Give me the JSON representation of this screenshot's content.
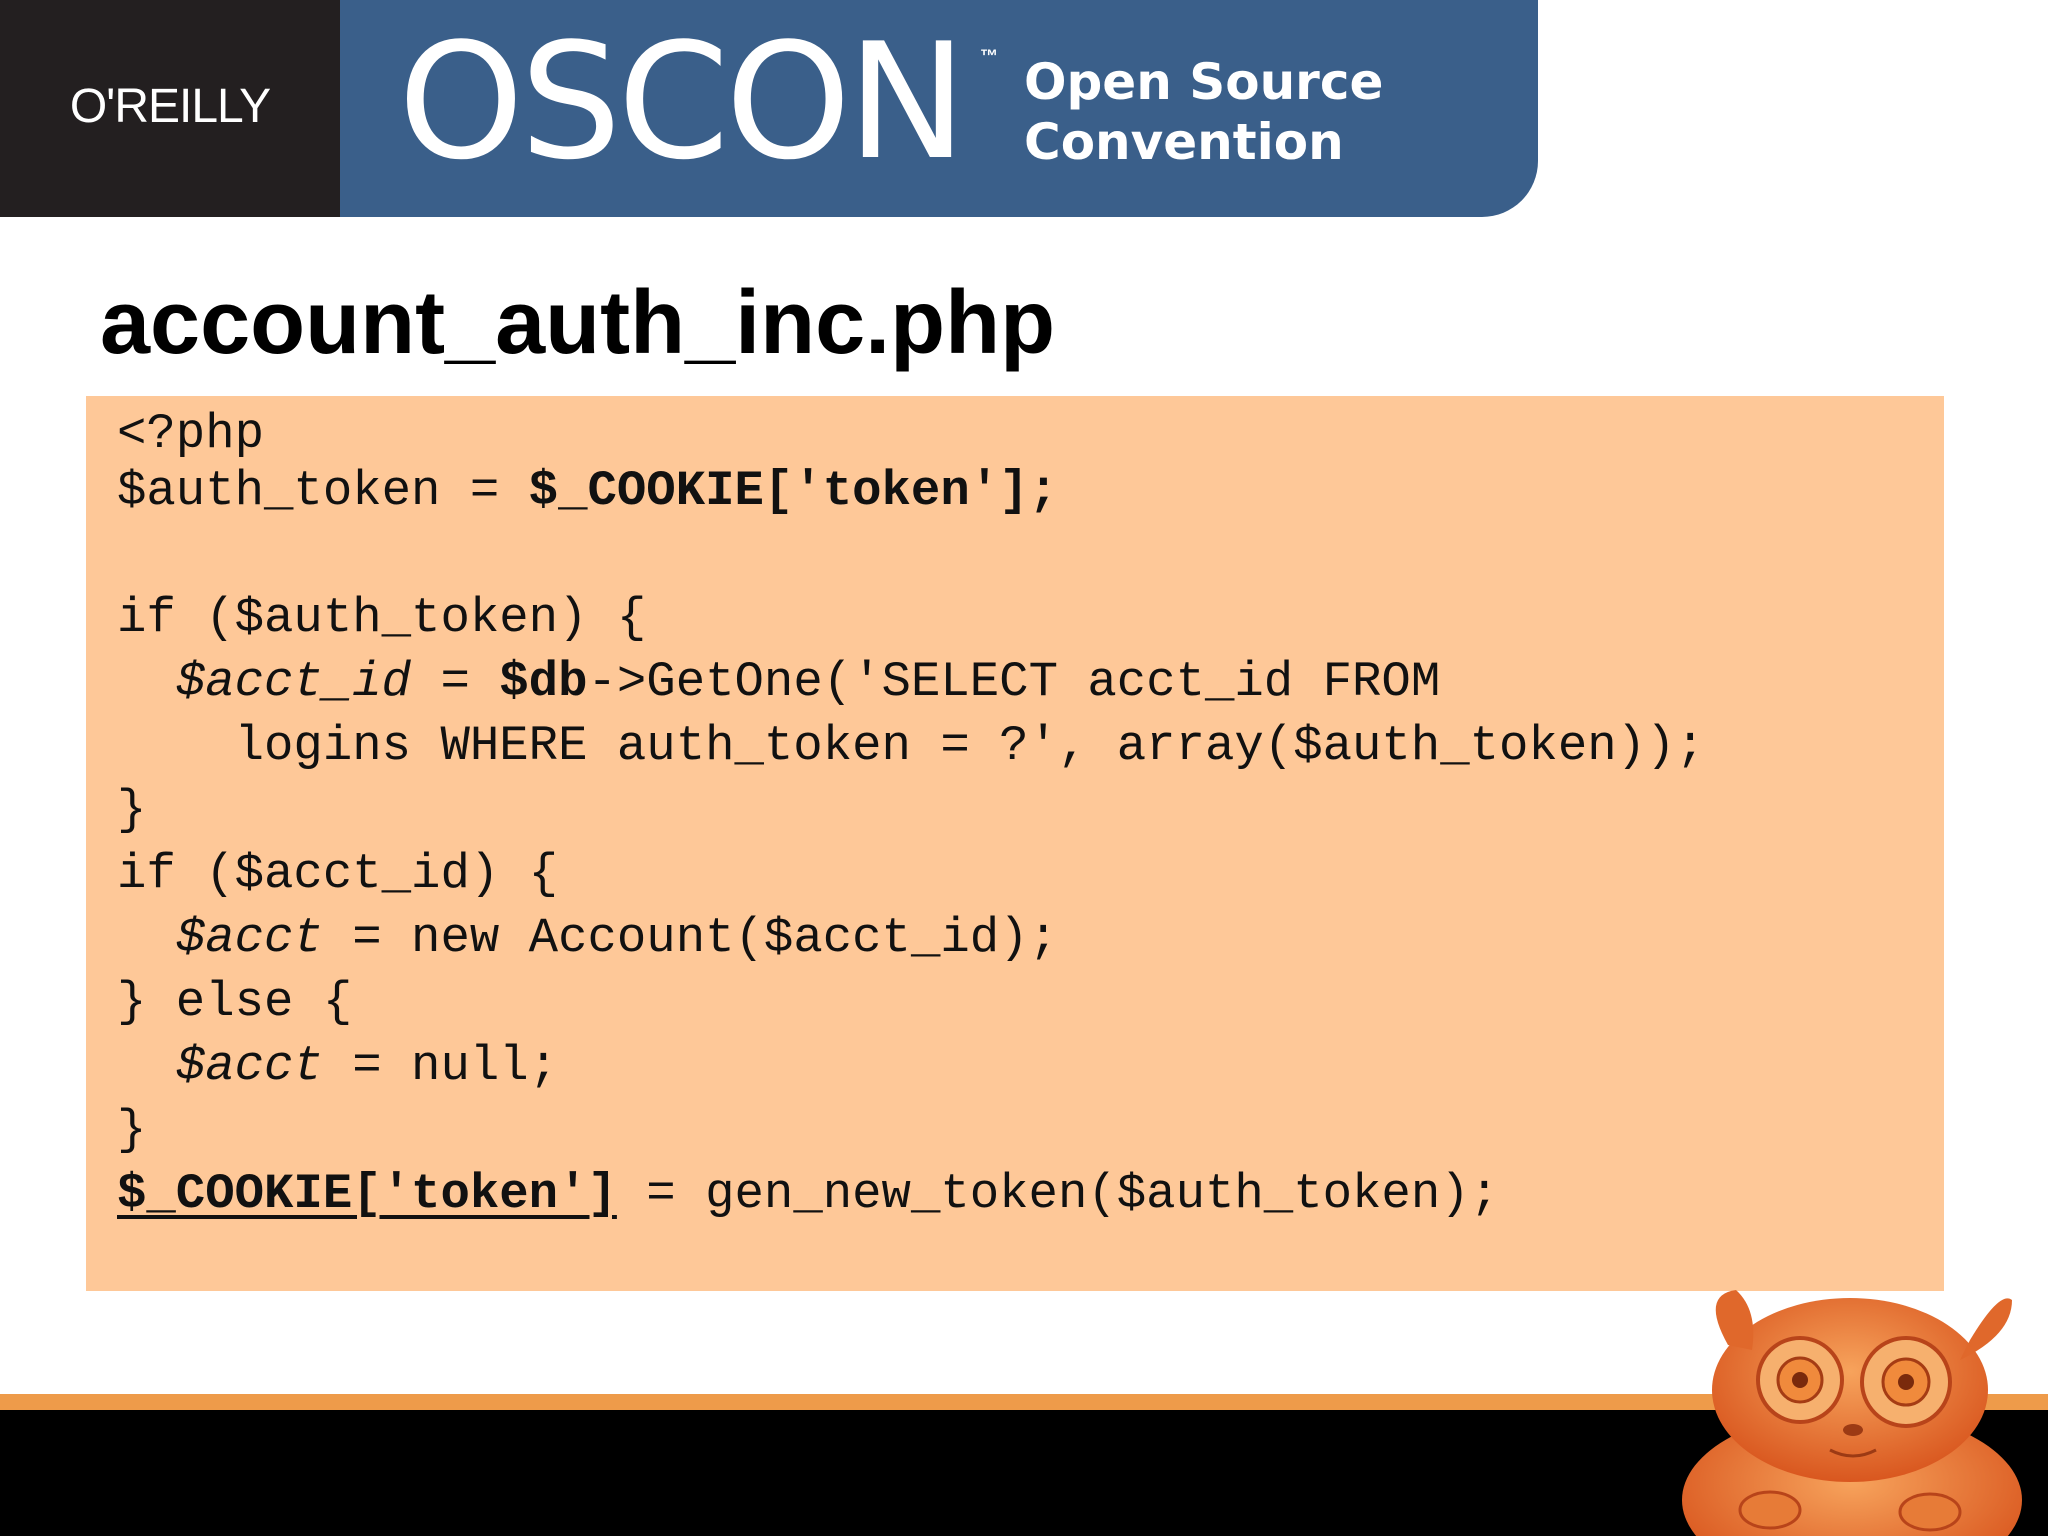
{
  "header": {
    "publisher_logo": "O'REILLY",
    "event_name": "OSCON",
    "trademark": "™",
    "tagline_line1": "Open Source",
    "tagline_line2": "Convention"
  },
  "slide": {
    "title": "account_auth_inc.php"
  },
  "code": {
    "lines": [
      [
        {
          "t": "<?php"
        }
      ],
      [
        {
          "t": "$auth_token = "
        },
        {
          "t": "$_COOKIE['token'];",
          "s": "bold"
        }
      ],
      [
        {
          "t": ""
        }
      ],
      [
        {
          "t": "if ($auth_token) {"
        }
      ],
      [
        {
          "t": "  "
        },
        {
          "t": "$acct_id",
          "s": "italic"
        },
        {
          "t": " = "
        },
        {
          "t": "$db",
          "s": "bold"
        },
        {
          "t": "->GetOne('SELECT acct_id FROM"
        }
      ],
      [
        {
          "t": "    logins WHERE auth_token = ?', array($auth_token));"
        }
      ],
      [
        {
          "t": "}"
        }
      ],
      [
        {
          "t": "if ($acct_id) {"
        }
      ],
      [
        {
          "t": "  "
        },
        {
          "t": "$acct",
          "s": "italic"
        },
        {
          "t": " = new Account($acct_id);"
        }
      ],
      [
        {
          "t": "} else {"
        }
      ],
      [
        {
          "t": "  "
        },
        {
          "t": "$acct",
          "s": "italic"
        },
        {
          "t": " = null;"
        }
      ],
      [
        {
          "t": "}"
        }
      ],
      [
        {
          "t": "$_COOKIE['token']",
          "s": "underline"
        },
        {
          "t": " = gen_new_token($auth_token);"
        }
      ]
    ]
  },
  "colors": {
    "banner_blue": "#3a5f8a",
    "logo_box": "#231f20",
    "code_background": "#fec898",
    "footer_stripe": "#ee9b4a",
    "footer_bar": "#000000"
  },
  "icons": {
    "mascot": "tarsier-mascot-icon"
  }
}
